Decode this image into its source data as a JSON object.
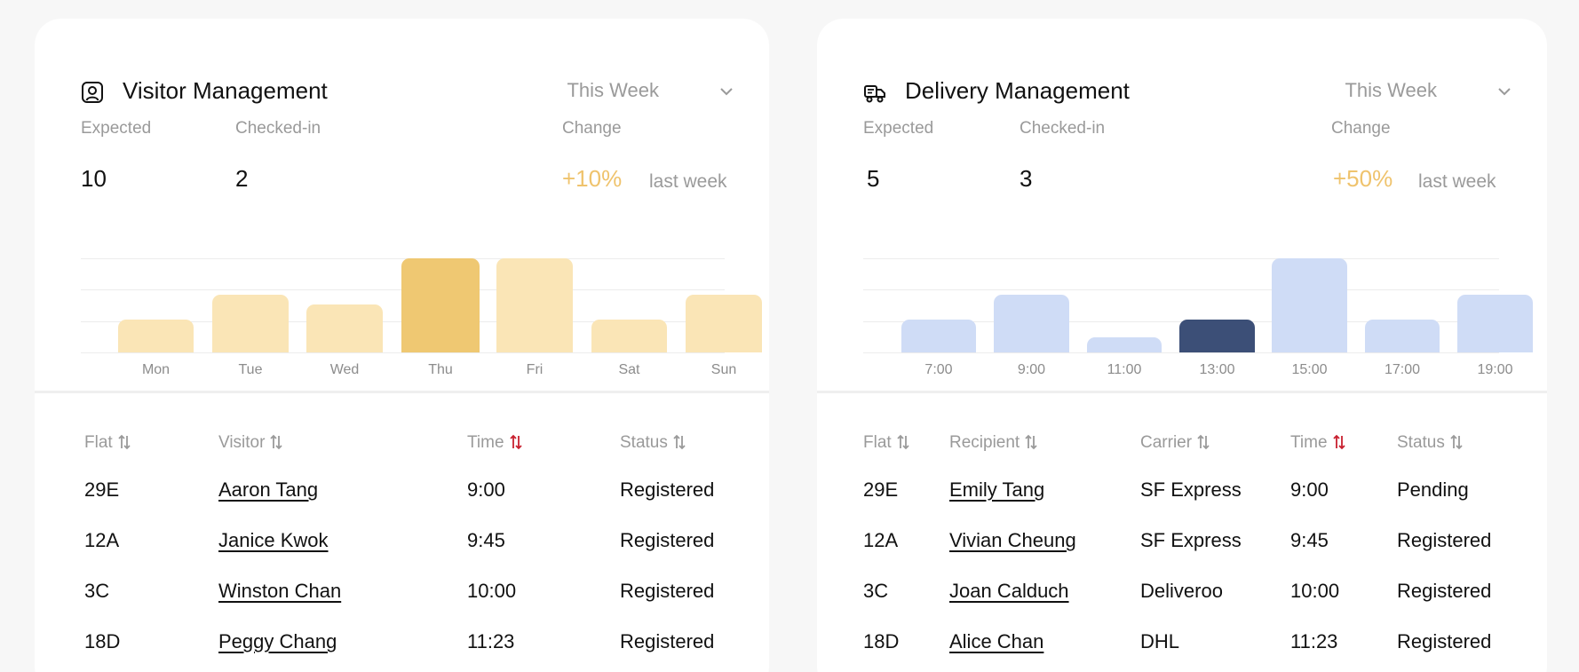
{
  "visitor": {
    "title": "Visitor Management",
    "period": "This Week",
    "stats": {
      "expected_label": "Expected",
      "expected_value": "10",
      "checked_label": "Checked-in",
      "checked_value": "2",
      "change_label": "Change",
      "change_value": "+10%",
      "change_note": "last week"
    },
    "chart_data": {
      "type": "bar",
      "categories": [
        "Mon",
        "Tue",
        "Wed",
        "Thu",
        "Fri",
        "Sat",
        "Sun"
      ],
      "values": [
        3,
        5.2,
        4.3,
        8.5,
        8.5,
        3,
        5.2
      ],
      "highlight_index": 3,
      "ylim": [
        0,
        8.5
      ],
      "grid": true,
      "colors": {
        "bar": "#fae5b6",
        "highlight": "#efc872"
      }
    },
    "table": {
      "headers": [
        "Flat",
        "Visitor",
        "Time",
        "Status"
      ],
      "active_sort": "Time",
      "rows": [
        [
          "29E",
          "Aaron Tang",
          "9:00",
          "Registered"
        ],
        [
          "12A",
          "Janice Kwok",
          "9:45",
          "Registered"
        ],
        [
          "3C",
          "Winston Chan",
          "10:00",
          "Registered"
        ],
        [
          "18D",
          "Peggy Chang",
          "11:23",
          "Registered"
        ]
      ]
    }
  },
  "delivery": {
    "title": "Delivery Management",
    "period": "This Week",
    "stats": {
      "expected_label": "Expected",
      "expected_value": "5",
      "checked_label": "Checked-in",
      "checked_value": "3",
      "change_label": "Change",
      "change_value": "+50%",
      "change_note": "last week"
    },
    "chart_data": {
      "type": "bar",
      "categories": [
        "7:00",
        "9:00",
        "11:00",
        "13:00",
        "15:00",
        "17:00",
        "19:00"
      ],
      "values": [
        3,
        5.2,
        1.4,
        3,
        8.5,
        3,
        5.2
      ],
      "highlight_index": 3,
      "ylim": [
        0,
        8.5
      ],
      "grid": true,
      "colors": {
        "bar": "#cfdcf6",
        "highlight": "#3c4f77"
      }
    },
    "table": {
      "headers": [
        "Flat",
        "Recipient",
        "Carrier",
        "Time",
        "Status"
      ],
      "active_sort": "Time",
      "rows": [
        [
          "29E",
          "Emily Tang",
          "SF Express",
          "9:00",
          "Pending"
        ],
        [
          "12A",
          "Vivian Cheung",
          "SF Express",
          "9:45",
          "Registered"
        ],
        [
          "3C",
          "Joan Calduch",
          "Deliveroo",
          "10:00",
          "Registered"
        ],
        [
          "18D",
          "Alice Chan",
          "DHL",
          "11:23",
          "Registered"
        ]
      ]
    }
  },
  "icons": {
    "visitor": "user-badge-icon",
    "delivery": "delivery-truck-icon",
    "dropdown": "chevron-down-icon",
    "sort": "sort-arrows-icon"
  },
  "colors": {
    "change": "#efc36d",
    "sort_active": "#c8202f",
    "sort_inactive": "#9a9a9a"
  }
}
